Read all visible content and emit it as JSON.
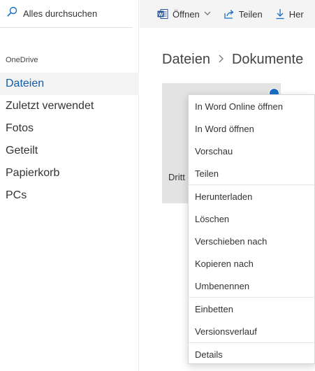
{
  "search": {
    "placeholder": "Alles durchsuchen"
  },
  "sidebar": {
    "brand": "OneDrive",
    "items": [
      {
        "label": "Dateien"
      },
      {
        "label": "Zuletzt verwendet"
      },
      {
        "label": "Fotos"
      },
      {
        "label": "Geteilt"
      },
      {
        "label": "Papierkorb"
      },
      {
        "label": "PCs"
      }
    ]
  },
  "toolbar": {
    "open_label": "Öffnen",
    "share_label": "Teilen",
    "download_label": "Her"
  },
  "breadcrumb": {
    "root": "Dateien",
    "current": "Dokumente"
  },
  "file": {
    "name": "Dritt"
  },
  "context_menu": {
    "groups": [
      [
        "In Word Online öffnen",
        "In Word öffnen",
        "Vorschau",
        "Teilen"
      ],
      [
        "Herunterladen",
        "Löschen",
        "Verschieben nach",
        "Kopieren nach",
        "Umbenennen"
      ],
      [
        "Einbetten",
        "Versionsverlauf"
      ],
      [
        "Details"
      ]
    ]
  },
  "colors": {
    "accent": "#0f5ca8",
    "word_blue": "#2b579a",
    "selection": "#1a6fc4"
  }
}
